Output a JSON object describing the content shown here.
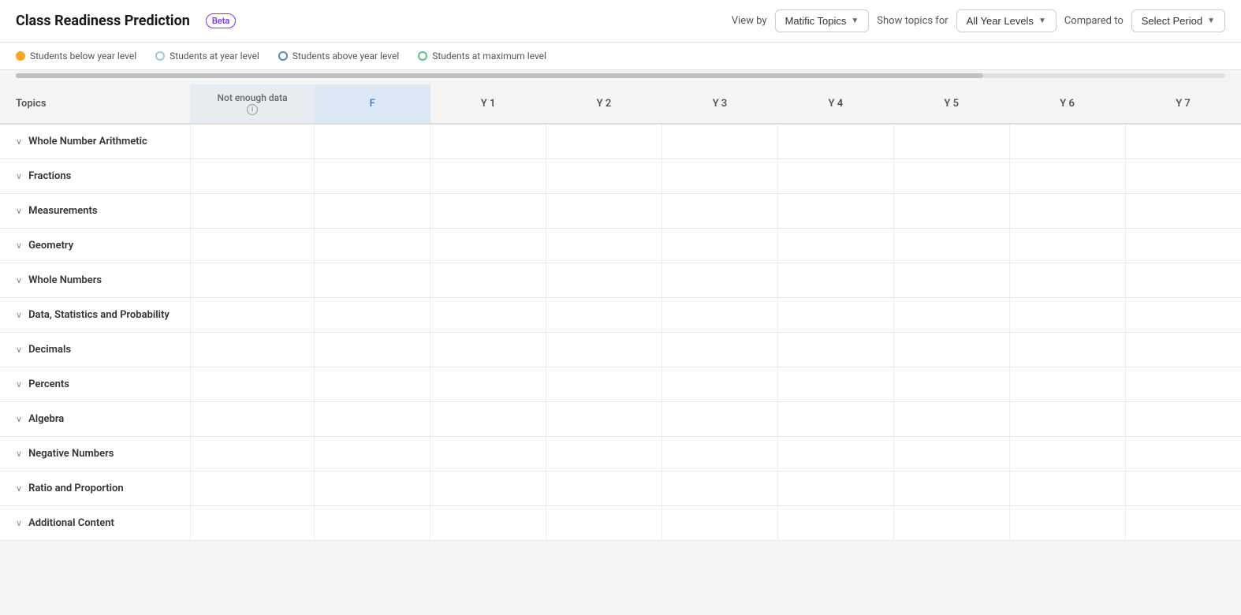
{
  "header": {
    "title": "Class Readiness Prediction",
    "beta_label": "Beta",
    "view_by_label": "View by",
    "view_by_value": "Matific Topics",
    "show_topics_label": "Show topics for",
    "show_topics_value": "All Year Levels",
    "compared_to_label": "Compared to",
    "compared_to_value": "Select Period"
  },
  "legend": {
    "items": [
      {
        "label": "Students below year level",
        "dot_class": "legend-dot-yellow"
      },
      {
        "label": "Students at year level",
        "dot_class": "legend-dot-blue-light"
      },
      {
        "label": "Students above year level",
        "dot_class": "legend-dot-blue"
      },
      {
        "label": "Students at maximum level",
        "dot_class": "legend-dot-green"
      }
    ]
  },
  "table": {
    "columns": {
      "topics": "Topics",
      "not_enough": "Not enough data",
      "f": "F",
      "years": [
        "Y 1",
        "Y 2",
        "Y 3",
        "Y 4",
        "Y 5",
        "Y 6",
        "Y 7"
      ]
    },
    "topics": [
      "Whole Number Arithmetic",
      "Fractions",
      "Measurements",
      "Geometry",
      "Whole Numbers",
      "Data, Statistics and Probability",
      "Decimals",
      "Percents",
      "Algebra",
      "Negative Numbers",
      "Ratio and Proportion",
      "Additional Content"
    ]
  },
  "info_icon": "i"
}
